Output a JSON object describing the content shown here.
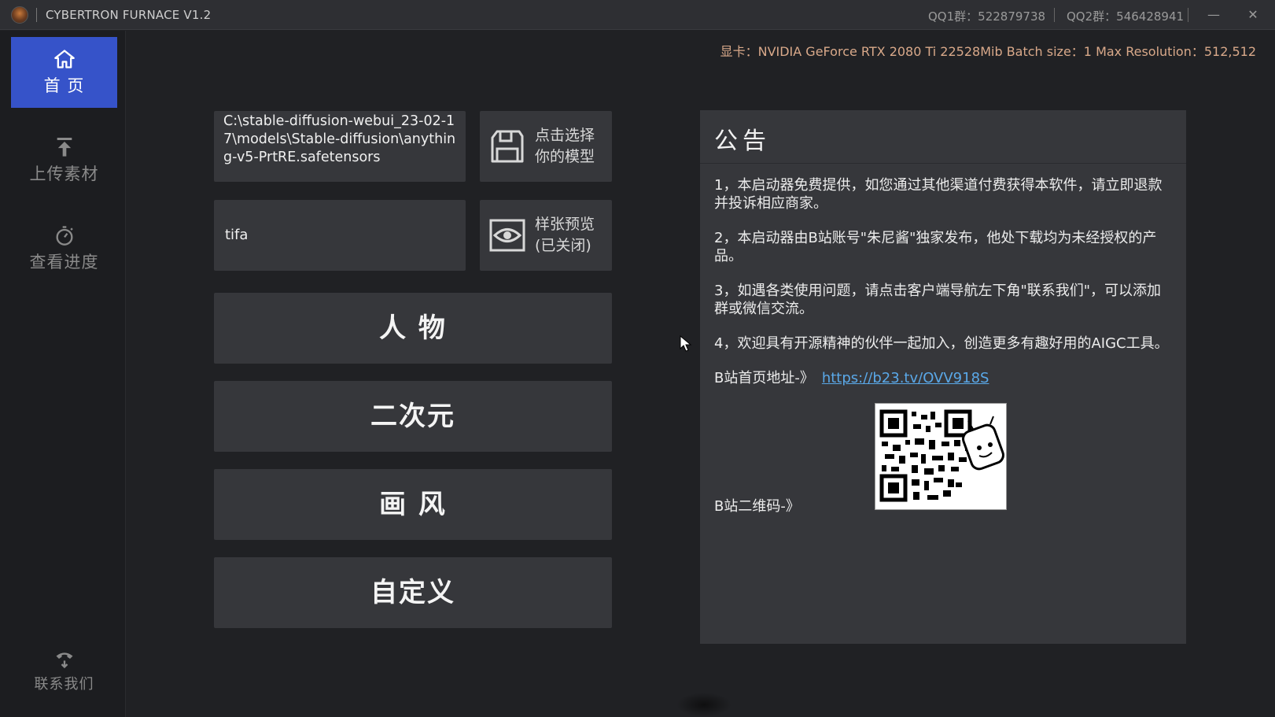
{
  "window": {
    "title": "CYBERTRON FURNACE V1.2",
    "qq1": "QQ1群：522879738",
    "qq2": "QQ2群：546428941",
    "minimize": "—",
    "close": "✕"
  },
  "sidebar": {
    "items": [
      {
        "label": "首 页",
        "icon": "home-icon",
        "active": true
      },
      {
        "label": "上传素材",
        "icon": "upload-icon",
        "active": false
      },
      {
        "label": "查看进度",
        "icon": "stopwatch-icon",
        "active": false
      }
    ],
    "contact": {
      "label": "联系我们",
      "icon": "phone-icon"
    }
  },
  "status": {
    "gpu_info": "显卡：NVIDIA GeForce RTX 2080 Ti 22528Mib  Batch size：1 Max Resolution：512,512"
  },
  "main": {
    "model_path": "C:\\stable-diffusion-webui_23-02-17\\models\\Stable-diffusion\\anything-v5-PrtRE.safetensors",
    "prompt_value": "tifa",
    "select_model_label_1": "点击选择",
    "select_model_label_2": "你的模型",
    "preview_label_1": "样张预览",
    "preview_label_2": "(已关闭)",
    "buttons": [
      "人 物",
      "二次元",
      "画 风",
      "自定义"
    ]
  },
  "notice": {
    "title": "公告",
    "items": [
      "1，本启动器免费提供，如您通过其他渠道付费获得本软件，请立即退款并投诉相应商家。",
      "2，本启动器由B站账号\"朱尼酱\"独家发布，他处下载均为未经授权的产品。",
      "3，如遇各类使用问题，请点击客户端导航左下角\"联系我们\"，可以添加群或微信交流。",
      "4，欢迎具有开源精神的伙伴一起加入，创造更多有趣好用的AIGC工具。"
    ],
    "homepage_label": "B站首页地址-》",
    "homepage_url": "https://b23.tv/OVV918S",
    "qr_label": "B站二维码-》"
  }
}
